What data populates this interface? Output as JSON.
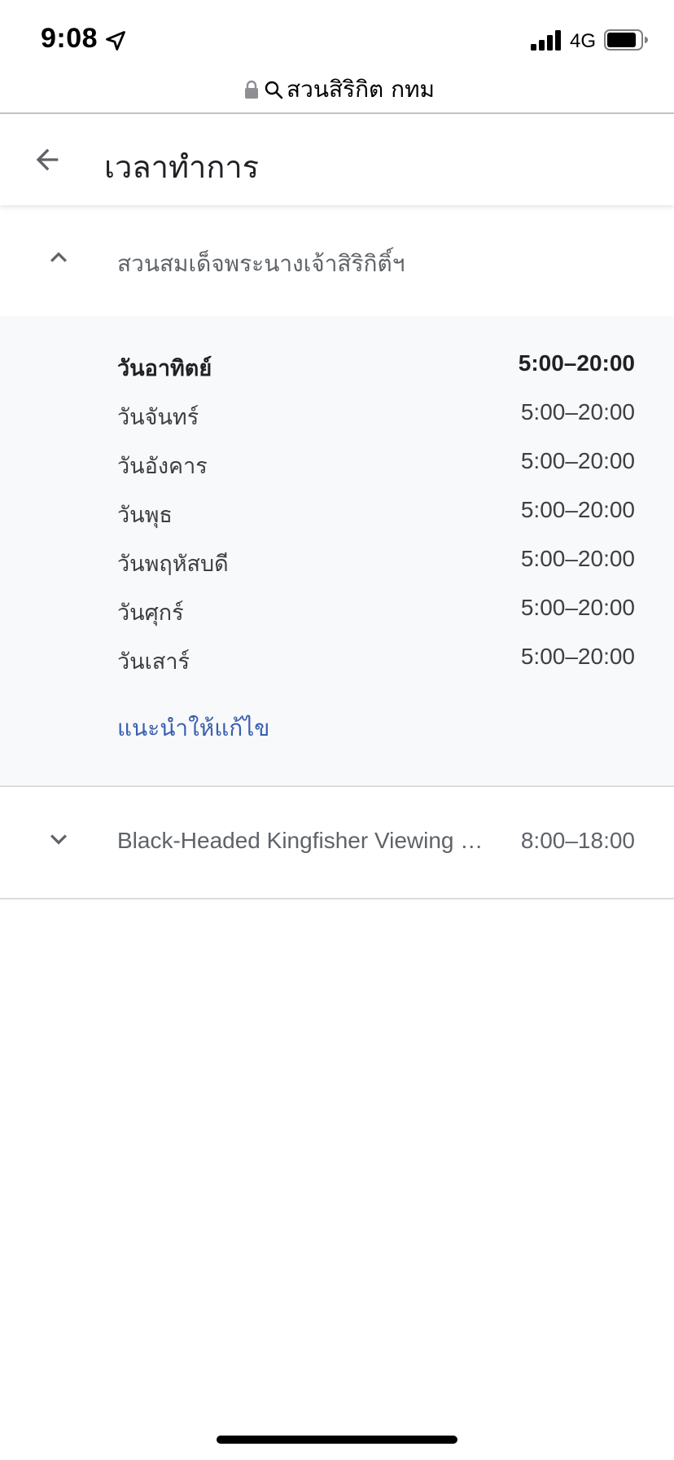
{
  "status_bar": {
    "time": "9:08",
    "network": "4G"
  },
  "url_bar": {
    "text": "สวนสิริกิต กทม"
  },
  "header": {
    "title": "เวลาทำการ"
  },
  "sections": [
    {
      "title": "สวนสมเด็จพระนางเจ้าสิริกิติ์ฯ",
      "expanded": true,
      "days": [
        {
          "day": "วันอาทิตย์",
          "hours": "5:00–20:00",
          "today": true
        },
        {
          "day": "วันจันทร์",
          "hours": "5:00–20:00",
          "today": false
        },
        {
          "day": "วันอังคาร",
          "hours": "5:00–20:00",
          "today": false
        },
        {
          "day": "วันพุธ",
          "hours": "5:00–20:00",
          "today": false
        },
        {
          "day": "วันพฤหัสบดี",
          "hours": "5:00–20:00",
          "today": false
        },
        {
          "day": "วันศุกร์",
          "hours": "5:00–20:00",
          "today": false
        },
        {
          "day": "วันเสาร์",
          "hours": "5:00–20:00",
          "today": false
        }
      ],
      "suggest_edit": "แนะนำให้แก้ไข"
    },
    {
      "title": "Black-Headed Kingfisher Viewing …",
      "expanded": false,
      "hours": "8:00–18:00"
    }
  ],
  "colors": {
    "link": "#3b5fb0",
    "panel_bg": "#f8f9fa",
    "divider": "#dadce0"
  }
}
